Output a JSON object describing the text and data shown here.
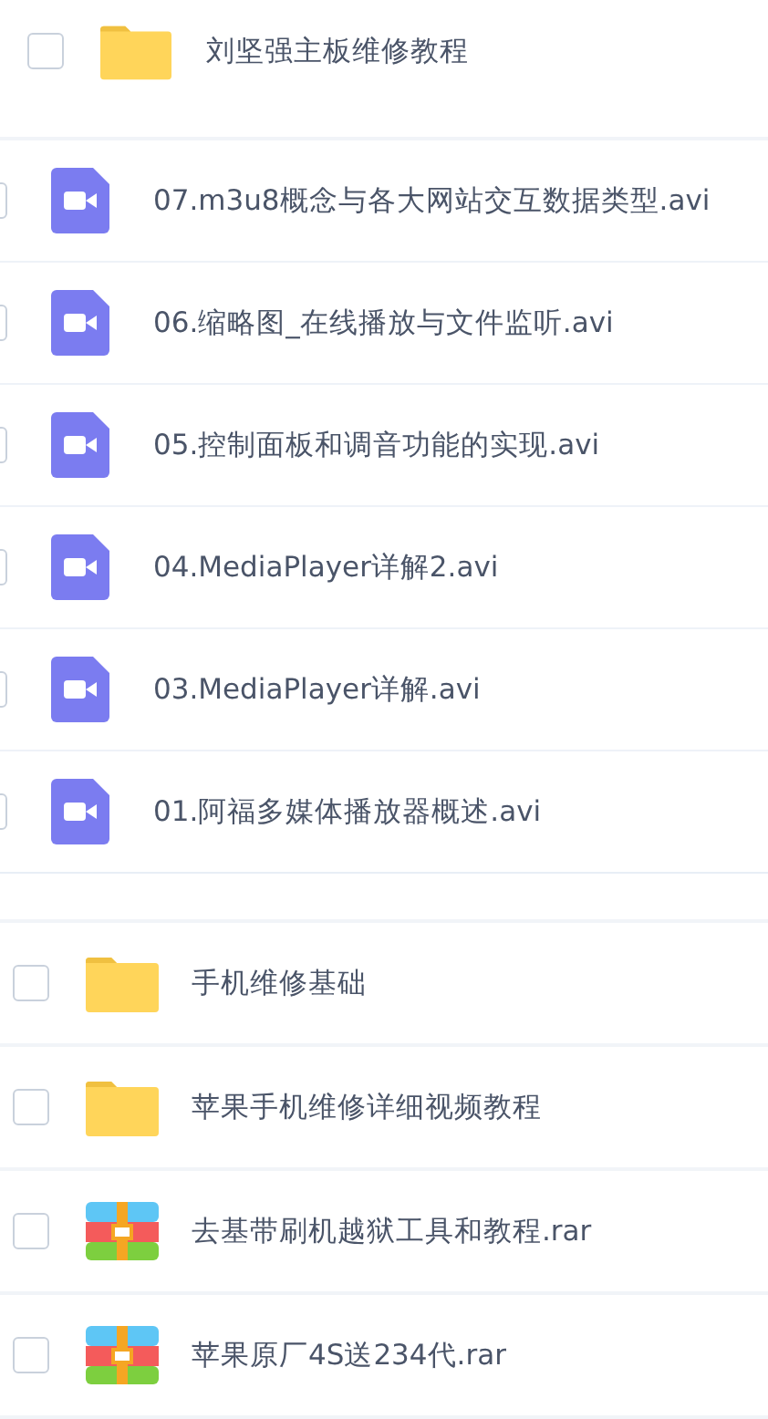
{
  "groups": [
    {
      "rows": [
        {
          "kind": "folder",
          "name": "刘坚强主板维修教程",
          "checked": false
        }
      ]
    },
    {
      "rows": [
        {
          "kind": "video",
          "name": "07.m3u8概念与各大网站交互数据类型.avi",
          "checked": false
        },
        {
          "kind": "video",
          "name": "06.缩略图_在线播放与文件监听.avi",
          "checked": false
        },
        {
          "kind": "video",
          "name": "05.控制面板和调音功能的实现.avi",
          "checked": false
        },
        {
          "kind": "video",
          "name": "04.MediaPlayer详解2.avi",
          "checked": false
        },
        {
          "kind": "video",
          "name": "03.MediaPlayer详解.avi",
          "checked": false
        },
        {
          "kind": "video",
          "name": "01.阿福多媒体播放器概述.avi",
          "checked": false
        }
      ]
    },
    {
      "rows": [
        {
          "kind": "folder",
          "name": "手机维修基础",
          "checked": false
        },
        {
          "kind": "folder",
          "name": "苹果手机维修详细视频教程",
          "checked": false
        },
        {
          "kind": "archive",
          "name": "去基带刷机越狱工具和教程.rar",
          "checked": false
        },
        {
          "kind": "archive",
          "name": "苹果原厂4S送234代.rar",
          "checked": false
        }
      ]
    }
  ]
}
